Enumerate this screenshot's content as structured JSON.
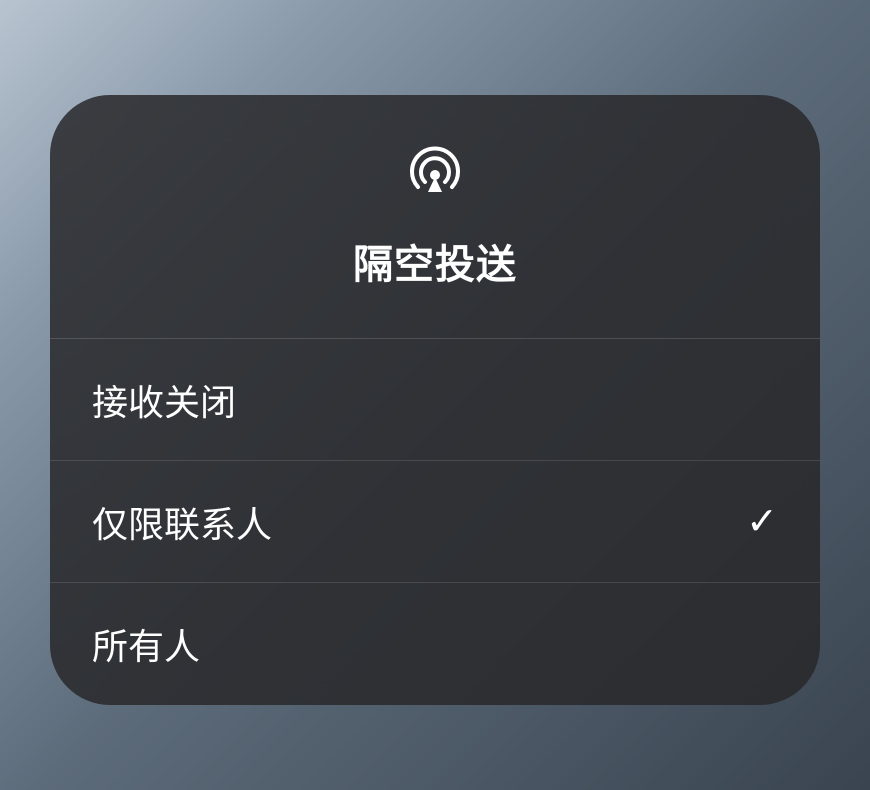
{
  "header": {
    "title": "隔空投送",
    "icon_name": "airdrop-icon"
  },
  "options": [
    {
      "label": "接收关闭",
      "selected": false
    },
    {
      "label": "仅限联系人",
      "selected": true
    },
    {
      "label": "所有人",
      "selected": false
    }
  ]
}
